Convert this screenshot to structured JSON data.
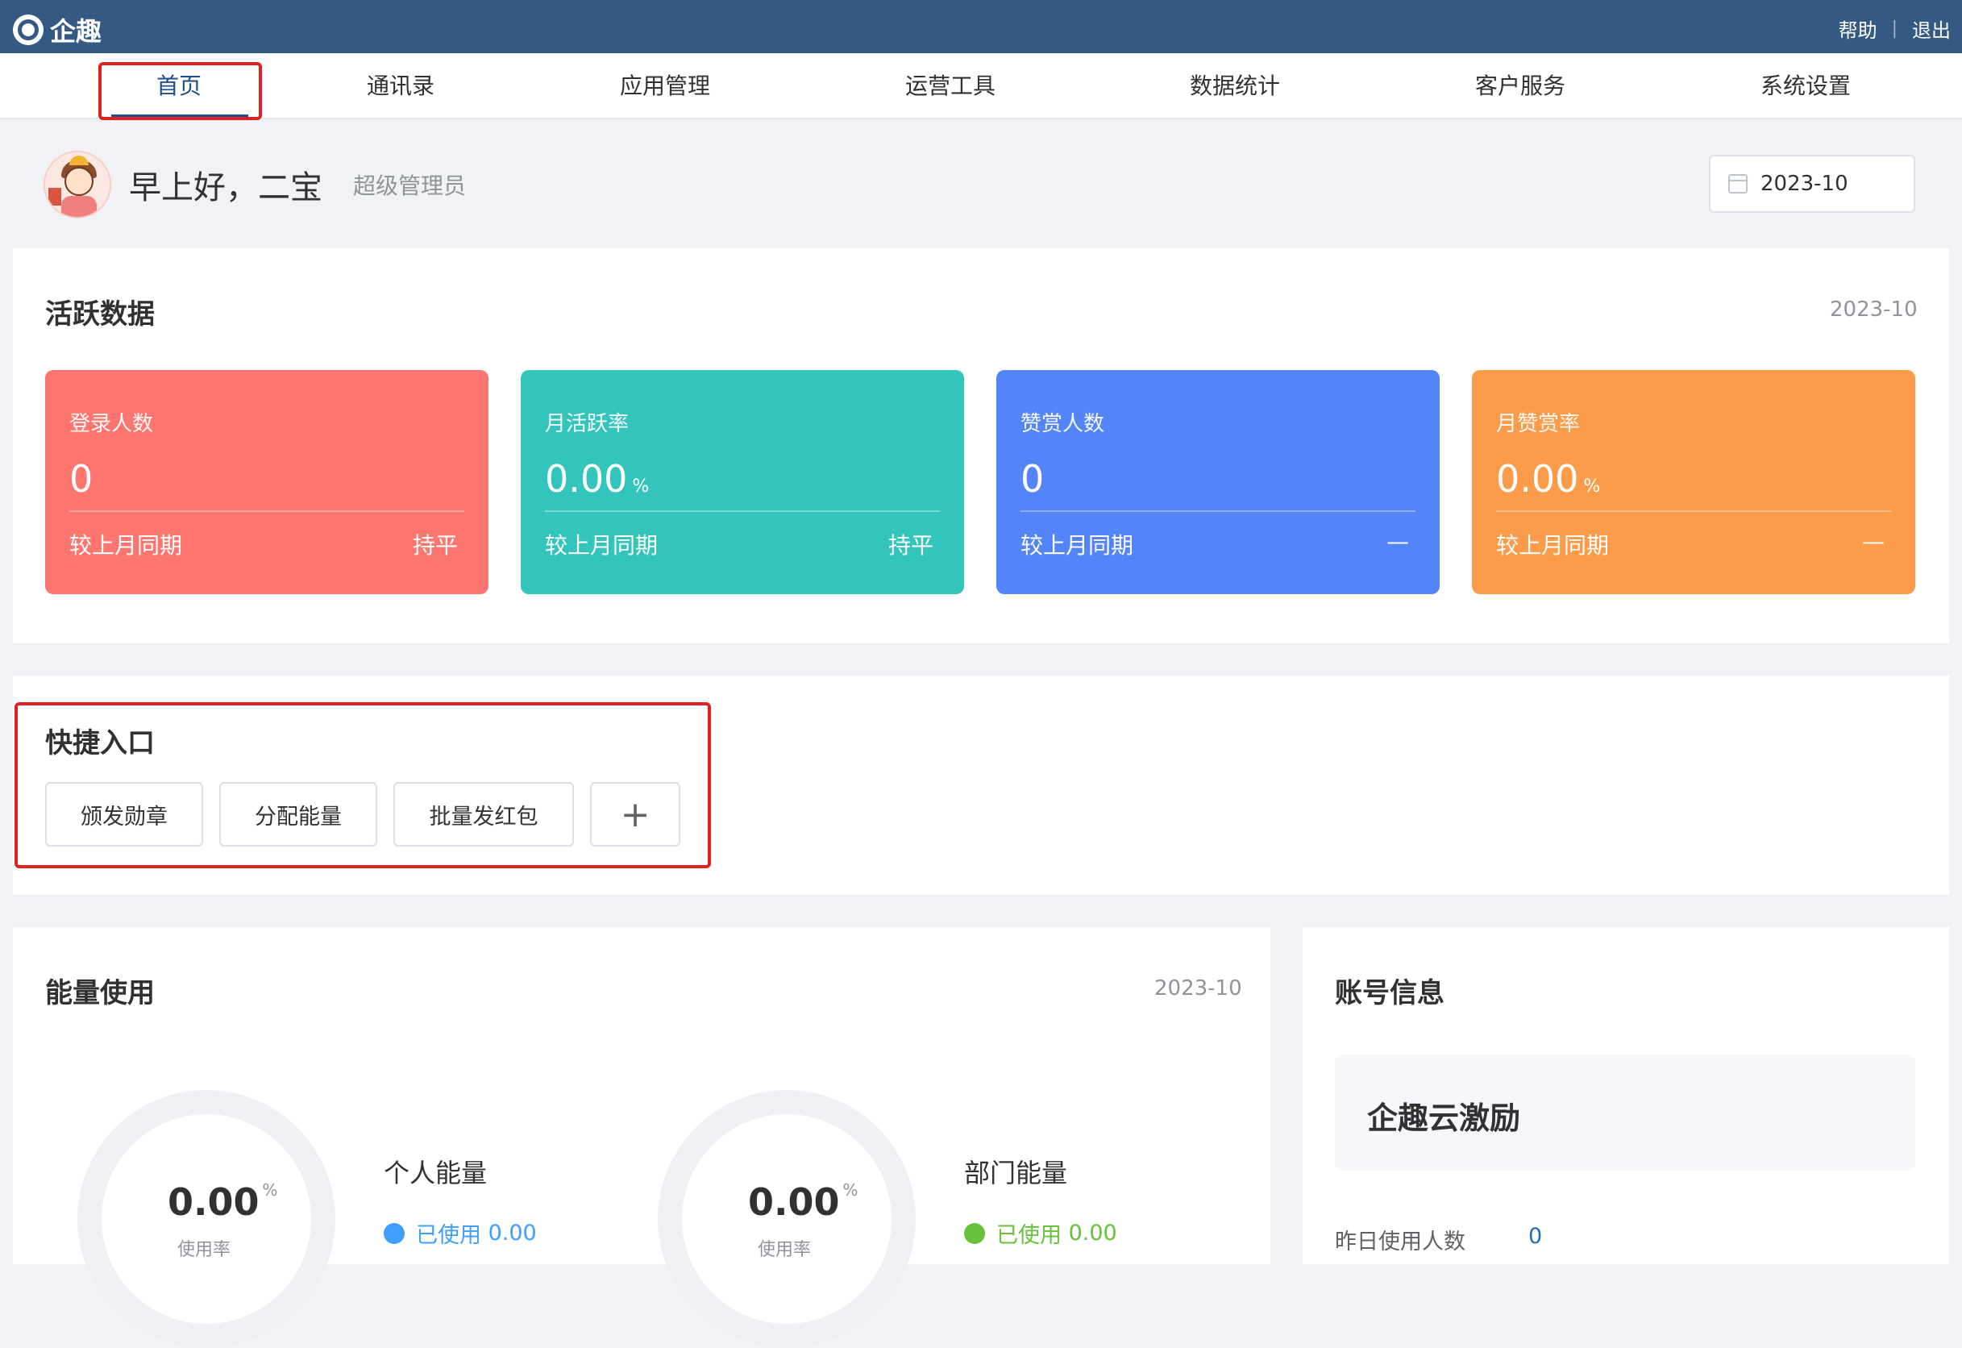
{
  "app": {
    "logo_text": "企趣"
  },
  "top_links": {
    "help": "帮助",
    "separator": "|",
    "logout": "退出"
  },
  "nav": {
    "items": [
      {
        "label": "首页",
        "active": true
      },
      {
        "label": "通讯录"
      },
      {
        "label": "应用管理"
      },
      {
        "label": "运营工具"
      },
      {
        "label": "数据统计"
      },
      {
        "label": "客户服务"
      },
      {
        "label": "系统设置"
      }
    ]
  },
  "header": {
    "greeting": "早上好，二宝",
    "role": "超级管理员",
    "month_picker_value": "2023-10"
  },
  "active_data": {
    "title": "活跃数据",
    "date": "2023-10",
    "cards": [
      {
        "label": "登录人数",
        "value": "0",
        "unit": "",
        "compare_label": "较上月同期",
        "trend": "持平",
        "color": "#fc766f"
      },
      {
        "label": "月活跃率",
        "value": "0.00",
        "unit": "%",
        "compare_label": "较上月同期",
        "trend": "持平",
        "color": "#33c4bb"
      },
      {
        "label": "赞赏人数",
        "value": "0",
        "unit": "",
        "compare_label": "较上月同期",
        "trend": "—",
        "color": "#5385f9"
      },
      {
        "label": "月赞赏率",
        "value": "0.00",
        "unit": "%",
        "compare_label": "较上月同期",
        "trend": "—",
        "color": "#fc9c4a"
      }
    ]
  },
  "quick_entry": {
    "title": "快捷入口",
    "buttons": [
      "颁发勋章",
      "分配能量",
      "批量发红包"
    ],
    "add_label": "+"
  },
  "energy_usage": {
    "title": "能量使用",
    "date": "2023-10",
    "personal": {
      "title": "个人能量",
      "rate": "0.00",
      "unit": "%",
      "rate_label": "使用率",
      "used_label": "已使用",
      "used_value": "0.00",
      "color": "#409eff"
    },
    "department": {
      "title": "部门能量",
      "rate": "0.00",
      "unit": "%",
      "rate_label": "使用率",
      "used_label": "已使用",
      "used_value": "0.00",
      "color": "#67c23a"
    }
  },
  "account_info": {
    "title": "账号信息",
    "product_name": "企趣云激励",
    "yesterday_users_label": "昨日使用人数",
    "yesterday_users_value": "0"
  }
}
